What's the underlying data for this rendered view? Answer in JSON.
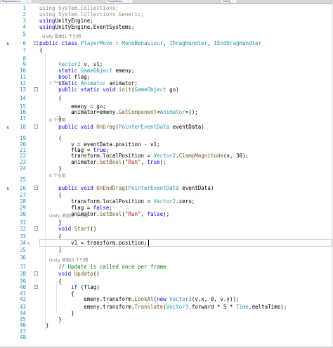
{
  "tabs": [
    "PlayerMove.cs",
    "PlayerMove",
    "Start()"
  ],
  "lines": [
    {
      "n": "1",
      "spans": [
        [
          "gray",
          "using System.Collections;"
        ]
      ]
    },
    {
      "n": "2",
      "spans": [
        [
          "gray",
          "using System.Collections.Generic;"
        ]
      ]
    },
    {
      "n": "3",
      "spans": [
        [
          "kw",
          "using"
        ],
        [
          "",
          "UnityEngine;"
        ]
      ]
    },
    {
      "n": "4",
      "spans": [
        [
          "kw",
          "using"
        ],
        [
          "",
          "UnityEngine.EventSystems;"
        ]
      ]
    },
    {
      "n": "5",
      "spans": []
    },
    {
      "n": "6",
      "spans": [
        [
          "kw",
          "public class "
        ],
        [
          "ty",
          "PlayerMove"
        ],
        [
          "",
          " : "
        ],
        [
          "ty",
          "MonoBehaviour"
        ],
        [
          "",
          ", "
        ],
        [
          "ty",
          "IDragHandler"
        ],
        [
          "",
          ", "
        ],
        [
          "ty",
          "IEndDragHandler"
        ]
      ]
    },
    {
      "n": "7",
      "spans": [
        [
          "",
          "{"
        ]
      ]
    },
    {
      "n": "8",
      "spans": []
    },
    {
      "n": "9",
      "spans": [
        [
          "",
          "      "
        ],
        [
          "ty",
          "Vector2"
        ],
        [
          "",
          " v, v1;"
        ]
      ]
    },
    {
      "n": "10",
      "spans": [
        [
          "",
          "      "
        ],
        [
          "kw",
          "static "
        ],
        [
          "ty",
          "GameObject"
        ],
        [
          "",
          " emeny;"
        ]
      ]
    },
    {
      "n": "11",
      "spans": [
        [
          "",
          "      "
        ],
        [
          "kw",
          "bool"
        ],
        [
          "",
          " flag;"
        ]
      ]
    },
    {
      "n": "12",
      "spans": [
        [
          "",
          "      "
        ],
        [
          "kw",
          "static "
        ],
        [
          "ty",
          "Animator"
        ],
        [
          "",
          " animator;"
        ]
      ]
    },
    {
      "n": "13",
      "spans": [
        [
          "",
          "      "
        ],
        [
          "kw",
          "public static void "
        ],
        [
          "mb",
          "init"
        ],
        [
          "",
          "("
        ],
        [
          "ty",
          "GameObject"
        ],
        [
          "",
          " go)"
        ]
      ]
    },
    {
      "n": "14",
      "spans": [
        [
          "",
          "      {"
        ]
      ]
    },
    {
      "n": "15",
      "spans": [
        [
          "",
          "          emeny = go;"
        ]
      ]
    },
    {
      "n": "16",
      "spans": [
        [
          "",
          "          animator=emeny."
        ],
        [
          "mb",
          "GetComponent"
        ],
        [
          "",
          "<"
        ],
        [
          "ty",
          "Animator"
        ],
        [
          "",
          ">();"
        ]
      ]
    },
    {
      "n": "17",
      "spans": [
        [
          "",
          "      }"
        ]
      ]
    },
    {
      "n": "18",
      "spans": [
        [
          "",
          "      "
        ],
        [
          "kw",
          "public void "
        ],
        [
          "mb",
          "OnDrag"
        ],
        [
          "",
          "("
        ],
        [
          "ty",
          "PointerEventData"
        ],
        [
          "",
          " eventData)"
        ]
      ]
    },
    {
      "n": "19",
      "spans": [
        [
          "",
          "      {"
        ]
      ]
    },
    {
      "n": "20",
      "spans": [
        [
          "",
          "          v = eventData.position - v1;"
        ]
      ]
    },
    {
      "n": "21",
      "spans": [
        [
          "",
          "          flag = "
        ],
        [
          "kw",
          "true"
        ],
        [
          "",
          ";"
        ]
      ]
    },
    {
      "n": "22",
      "spans": [
        [
          "",
          "          transform.localPosition = "
        ],
        [
          "ty",
          "Vector2"
        ],
        [
          "",
          "."
        ],
        [
          "mb",
          "ClampMagnitude"
        ],
        [
          "",
          "(v, 30);"
        ]
      ]
    },
    {
      "n": "23",
      "spans": [
        [
          "",
          "          animator."
        ],
        [
          "mb",
          "SetBool"
        ],
        [
          "",
          "("
        ],
        [
          "str",
          "\"Run\""
        ],
        [
          "",
          ", "
        ],
        [
          "kw",
          "true"
        ],
        [
          "",
          ");"
        ]
      ]
    },
    {
      "n": "24",
      "spans": [
        [
          "",
          "      }"
        ]
      ]
    },
    {
      "n": "25",
      "spans": []
    },
    {
      "n": "26",
      "spans": [
        [
          "",
          "      "
        ],
        [
          "kw",
          "public void "
        ],
        [
          "mb",
          "OnEndDrag"
        ],
        [
          "",
          "("
        ],
        [
          "ty",
          "PointerEventData"
        ],
        [
          "",
          " eventData)"
        ]
      ]
    },
    {
      "n": "27",
      "spans": [
        [
          "",
          "      {"
        ]
      ]
    },
    {
      "n": "28",
      "spans": [
        [
          "",
          "          transform.localPosition = "
        ],
        [
          "ty",
          "Vector2"
        ],
        [
          "",
          ".zero;"
        ]
      ]
    },
    {
      "n": "29",
      "spans": [
        [
          "",
          "          flag = "
        ],
        [
          "kw",
          "false"
        ],
        [
          "",
          ";"
        ]
      ]
    },
    {
      "n": "30",
      "spans": [
        [
          "",
          "          animator."
        ],
        [
          "mb",
          "SetBool"
        ],
        [
          "",
          "("
        ],
        [
          "str",
          "\"Run\""
        ],
        [
          "",
          ", "
        ],
        [
          "kw",
          "false"
        ],
        [
          "",
          ");"
        ]
      ]
    },
    {
      "n": "31",
      "spans": [
        [
          "",
          "      }"
        ]
      ]
    },
    {
      "n": "32",
      "spans": [
        [
          "",
          "      "
        ],
        [
          "kw",
          "void "
        ],
        [
          "mb",
          "Start"
        ],
        [
          "",
          "()"
        ]
      ]
    },
    {
      "n": "33",
      "spans": [
        [
          "",
          "      {"
        ]
      ]
    },
    {
      "n": "34",
      "spans": [
        [
          "",
          "          v1 = transform.position;"
        ]
      ]
    },
    {
      "n": "35",
      "spans": [
        [
          "",
          "      }"
        ]
      ]
    },
    {
      "n": "36",
      "spans": []
    },
    {
      "n": "37",
      "spans": [
        [
          "",
          "      "
        ],
        [
          "cm",
          "// Update is called once per frame"
        ]
      ]
    },
    {
      "n": "38",
      "spans": [
        [
          "",
          "      "
        ],
        [
          "kw",
          "void "
        ],
        [
          "mb",
          "Update"
        ],
        [
          "",
          "()"
        ]
      ]
    },
    {
      "n": "39",
      "spans": [
        [
          "",
          "      {"
        ]
      ]
    },
    {
      "n": "40",
      "spans": [
        [
          "",
          "          "
        ],
        [
          "kw",
          "if"
        ],
        [
          "",
          " (flag)"
        ]
      ]
    },
    {
      "n": "41",
      "spans": [
        [
          "",
          "          {"
        ]
      ]
    },
    {
      "n": "42",
      "spans": [
        [
          "",
          "              emeny.transform."
        ],
        [
          "mb",
          "LookAt"
        ],
        [
          "",
          "("
        ],
        [
          "kw",
          "new "
        ],
        [
          "ty",
          "Vector3"
        ],
        [
          "",
          "(v.x, 0, v.y));"
        ]
      ]
    },
    {
      "n": "43",
      "spans": [
        [
          "",
          "              emeny.transform."
        ],
        [
          "mb",
          "Translate"
        ],
        [
          "",
          "("
        ],
        [
          "ty",
          "Vector3"
        ],
        [
          "",
          ".forward * 5 * "
        ],
        [
          "ty",
          "Time"
        ],
        [
          "",
          ".deltaTime);"
        ]
      ]
    },
    {
      "n": "44",
      "spans": [
        [
          "",
          "          }"
        ]
      ]
    },
    {
      "n": "45",
      "spans": [
        [
          "",
          "      }"
        ]
      ]
    },
    {
      "n": "46",
      "spans": [
        [
          "",
          "  }"
        ]
      ]
    },
    {
      "n": "47",
      "spans": []
    },
    {
      "n": "48",
      "spans": []
    }
  ],
  "codelens": {
    "class": "Unity 脚本|1 个引用",
    "init": "1 个引用",
    "ondrag": "0 个引用",
    "onenddrag": "0 个引用",
    "start": "Unity 消息|0 个引用",
    "update": "Unity 消息|0 个引用"
  },
  "override_markers": [
    "6",
    "18",
    "26"
  ],
  "edit_marker_line": "34"
}
